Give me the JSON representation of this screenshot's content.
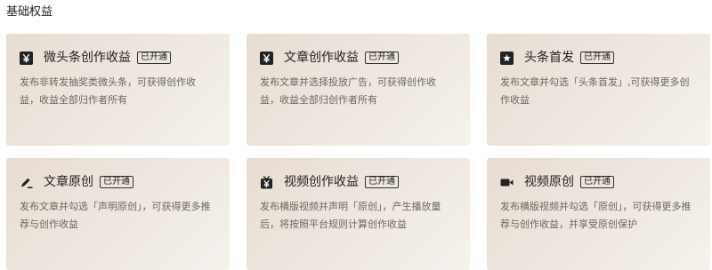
{
  "section": {
    "title": "基础权益"
  },
  "cards": [
    {
      "title": "微头条创作收益",
      "badge": "已开通",
      "desc": "发布非转发抽奖类微头条，可获得创作收益，收益全部归作者所有",
      "icon": "yen-icon"
    },
    {
      "title": "文章创作收益",
      "badge": "已开通",
      "desc": "发布文章并选择投放广告，可获得创作收益，收益全部归创作者所有",
      "icon": "yen-icon"
    },
    {
      "title": "头条首发",
      "badge": "已开通",
      "desc": "发布文章并勾选「头条首发」,可获得更多创作收益",
      "icon": "star-icon"
    },
    {
      "title": "文章原创",
      "badge": "已开通",
      "desc": "发布文章并勾选「声明原创」，可获得更多推荐与创作收益",
      "icon": "pen-icon"
    },
    {
      "title": "视频创作收益",
      "badge": "已开通",
      "desc": "发布横版视频并声明「原创」，产生播放量后，将按照平台规则计算创作收益",
      "icon": "tv-yen-icon"
    },
    {
      "title": "视频原创",
      "badge": "已开通",
      "desc": "发布横版视频并勾选「原创」，可获得更多推荐与创作收益，并享受原创保护",
      "icon": "video-camera-icon"
    }
  ]
}
